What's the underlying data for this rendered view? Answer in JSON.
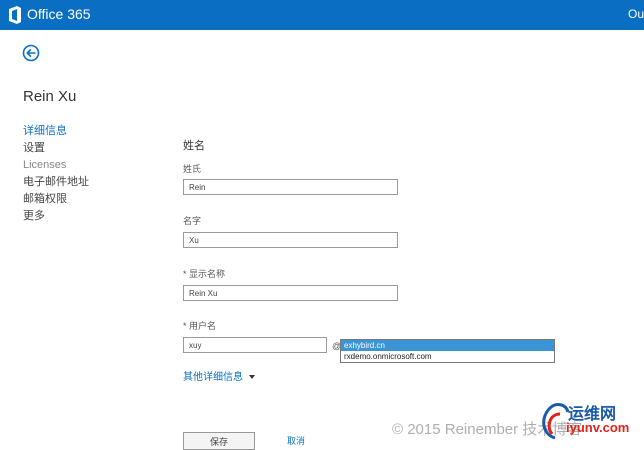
{
  "header": {
    "brand": "Office 365",
    "user_short": "Ou"
  },
  "user": {
    "display_name": "Rein Xu"
  },
  "nav": {
    "items": [
      {
        "label": "详细信息"
      },
      {
        "label": "设置"
      },
      {
        "label": "Licenses"
      },
      {
        "label": "电子邮件地址"
      },
      {
        "label": "邮箱权限"
      },
      {
        "label": "更多"
      }
    ]
  },
  "form": {
    "section_title": "姓名",
    "last_name": {
      "label": "姓氏",
      "value": "Rein"
    },
    "first_name": {
      "label": "名字",
      "value": "Xu"
    },
    "display_name": {
      "label": "* 显示名称",
      "value": "Rein Xu"
    },
    "username": {
      "label": "* 用户名",
      "value": "xuy",
      "at": "@"
    },
    "domain_options": [
      "exhybird.cn",
      "rxdemo.onmicrosoft.com"
    ],
    "more_details": "其他详细信息",
    "save": "保存",
    "cancel": "取消"
  },
  "watermark": "© 2015 Reinember 技术博客",
  "site_logo": {
    "title": "运维网",
    "url": "iyunv.com"
  },
  "colors": {
    "header_bg": "#0a6fc2",
    "accent": "#0a6fc2",
    "selected_option": "#3b94d4"
  }
}
